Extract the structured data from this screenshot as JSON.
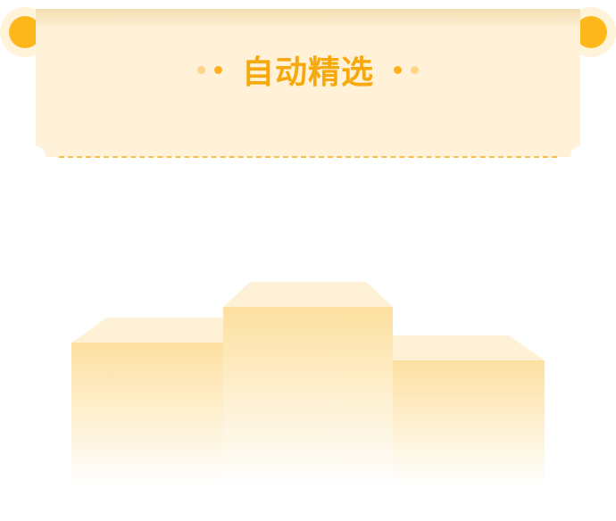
{
  "banner": {
    "title": "自动精选"
  },
  "colors": {
    "accent": "#ffb81c",
    "title": "#f7a90b",
    "panel": "#fff2d9",
    "podium_top": "#fde3a4"
  },
  "icons": [
    "decorative-dots",
    "scroll-cap",
    "podium"
  ]
}
